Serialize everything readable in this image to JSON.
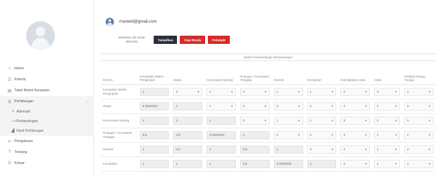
{
  "user": {
    "email": "maneeli@gmail.com"
  },
  "sidebar": {
    "items": [
      {
        "icon": "⌂",
        "label": "Home"
      },
      {
        "icon": "☷",
        "label": "Kriteria"
      },
      {
        "icon": "▤",
        "label": "Tabel Bobot Komputer"
      },
      {
        "icon": "⚖",
        "label": "Perhitungan",
        "chevron": "⌄"
      }
    ],
    "sub_items": [
      {
        "icon": "#",
        "label": "Alternatif"
      },
      {
        "icon": "⟿",
        "label": "Perbandingan"
      },
      {
        "icon": "▟",
        "label": "Hasil Perhitungan"
      }
    ],
    "after_items": [
      {
        "icon": "✂",
        "label": "Pengaturan",
        "chevron": "‹"
      },
      {
        "icon": "?",
        "label": "Tentang"
      },
      {
        "icon": "⏻",
        "label": "Keluar"
      }
    ]
  },
  "filter": {
    "label": "Skalakan ntb Untuk Memulai",
    "btn_show": "Tampilkan",
    "btn_ready": "Siap Ready",
    "btn_help": "Petunjuk"
  },
  "matrix": {
    "title": "Matrik Perbandingan Berpasangan",
    "headers": [
      "Kriteria",
      "Kecepatan Waktu Pengerjaan",
      "Harga",
      "Kesesuaian Barang",
      "Ruangan / Kecepatan Tanggap",
      "Garansi",
      "Kecepatan",
      "Kelengkapan Jasa",
      "Jarak",
      "Fasilitas Ruang Tunggu"
    ],
    "rows": [
      {
        "label": "Kecepatan Waktu Pengerjaan",
        "cells": [
          [
            "box",
            "1"
          ],
          [
            "sel",
            "3"
          ],
          [
            "sel",
            "1"
          ],
          [
            "sel",
            "2"
          ],
          [
            "sel",
            "1"
          ],
          [
            "sel",
            "1"
          ],
          [
            "sel",
            "3"
          ],
          [
            "sel",
            "3"
          ],
          [
            "sel",
            "3"
          ]
        ]
      },
      {
        "label": "Harga",
        "cells": [
          [
            "box",
            "0.3333333"
          ],
          [
            "box",
            "1"
          ],
          [
            "sel",
            "1"
          ],
          [
            "sel",
            "2"
          ],
          [
            "sel",
            "2"
          ],
          [
            "sel",
            "1"
          ],
          [
            "sel",
            "2"
          ],
          [
            "sel",
            "1"
          ],
          [
            "sel",
            "3"
          ]
        ]
      },
      {
        "label": "Kesesuaian Barang",
        "cells": [
          [
            "box",
            "1"
          ],
          [
            "box",
            "1"
          ],
          [
            "box",
            "1"
          ],
          [
            "sel",
            "3"
          ],
          [
            "sel",
            "1"
          ],
          [
            "sel",
            "1"
          ],
          [
            "sel",
            "3"
          ],
          [
            "sel",
            "2"
          ],
          [
            "sel",
            "3"
          ]
        ]
      },
      {
        "label": "Ruangan / Kecepatan Tanggap",
        "cells": [
          [
            "box",
            "0.5"
          ],
          [
            "box",
            "0.5"
          ],
          [
            "box",
            "0.3333333"
          ],
          [
            "box",
            "1"
          ],
          [
            "sel",
            "2"
          ],
          [
            "sel",
            "2"
          ],
          [
            "sel",
            "3"
          ],
          [
            "sel",
            "1"
          ],
          [
            "sel",
            "1"
          ]
        ]
      },
      {
        "label": "Garansi",
        "cells": [
          [
            "box",
            "1"
          ],
          [
            "box",
            "0.5"
          ],
          [
            "box",
            "1"
          ],
          [
            "box",
            "0.5"
          ],
          [
            "box",
            "1"
          ],
          [
            "sel",
            "3"
          ],
          [
            "sel",
            "3"
          ],
          [
            "sel",
            "1"
          ],
          [
            "sel",
            "3"
          ]
        ]
      },
      {
        "label": "Kecepatan",
        "cells": [
          [
            "box",
            "1"
          ],
          [
            "box",
            "1"
          ],
          [
            "box",
            "1"
          ],
          [
            "box",
            "0.5"
          ],
          [
            "box",
            "0.3333333"
          ],
          [
            "box",
            "1"
          ],
          [
            "sel",
            "3"
          ],
          [
            "sel",
            "1"
          ],
          [
            "sel",
            "3"
          ]
        ]
      }
    ]
  }
}
